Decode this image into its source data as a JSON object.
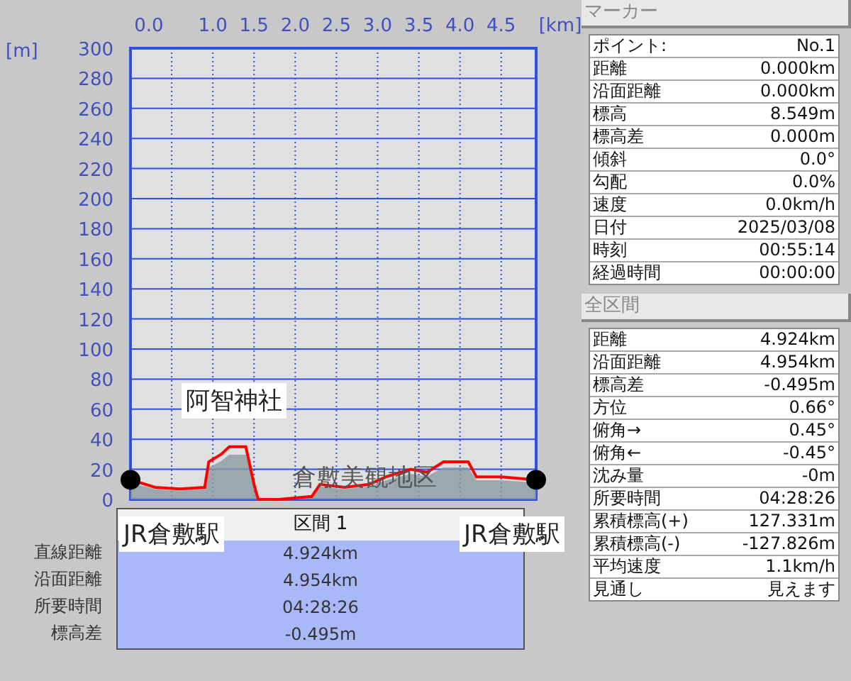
{
  "chart": {
    "chart_data": {
      "type": "line",
      "xlabel": "[km]",
      "ylabel": "[m]",
      "x": [
        0,
        0.3,
        0.6,
        0.9,
        0.95,
        1.1,
        1.2,
        1.4,
        1.5,
        1.55,
        1.8,
        2.2,
        2.3,
        2.6,
        2.9,
        3.1,
        3.4,
        3.6,
        3.8,
        4.1,
        4.2,
        4.5,
        4.924
      ],
      "grid": true,
      "series": [
        {
          "color": "#ff0000",
          "values": [
            13,
            8,
            7,
            8,
            25,
            30,
            35,
            35,
            10,
            0,
            0,
            2,
            10,
            8,
            10,
            15,
            20,
            18,
            25,
            25,
            15,
            15,
            13
          ]
        }
      ],
      "xlim": [
        0,
        4.924
      ],
      "ylim": [
        0,
        300
      ],
      "xticks": [
        {
          "value": 0,
          "label": "0.0"
        },
        {
          "value": 1,
          "label": "1.0"
        },
        {
          "value": 1.5,
          "label": "1.5"
        },
        {
          "value": 2,
          "label": "2.0"
        },
        {
          "value": 2.5,
          "label": "2.5"
        },
        {
          "value": 3,
          "label": "3.0"
        },
        {
          "value": 3.5,
          "label": "3.5"
        },
        {
          "value": 4,
          "label": "4.0"
        },
        {
          "value": 4.5,
          "label": "4.5"
        }
      ],
      "yticks": [
        0,
        20,
        40,
        60,
        80,
        100,
        120,
        140,
        160,
        180,
        200,
        220,
        240,
        260,
        280,
        300
      ]
    }
  },
  "place_labels": [
    {
      "text": "阿智神社",
      "kind": "boxed"
    },
    {
      "text": "倉敷美観地区",
      "kind": "plain"
    },
    {
      "text": "JR倉敷駅",
      "kind": "boxed"
    },
    {
      "text": "JR倉敷駅",
      "kind": "boxed"
    }
  ],
  "section": {
    "title": "区間 1",
    "rows": [
      {
        "label": "直線距離",
        "value": "4.924km"
      },
      {
        "label": "沿面距離",
        "value": "4.954km"
      },
      {
        "label": "所要時間",
        "value": "04:28:26"
      },
      {
        "label": "標高差",
        "value": "-0.495m"
      }
    ]
  },
  "marker_panel": {
    "title": "マーカー",
    "rows": [
      {
        "label": "ポイント:",
        "value": "No.1"
      },
      {
        "label": "距離",
        "value": "0.000km"
      },
      {
        "label": "沿面距離",
        "value": "0.000km"
      },
      {
        "label": "標高",
        "value": "8.549m"
      },
      {
        "label": "標高差",
        "value": "0.000m"
      },
      {
        "label": "傾斜",
        "value": "0.0°"
      },
      {
        "label": "勾配",
        "value": "0.0%"
      },
      {
        "label": "速度",
        "value": "0.0km/h"
      },
      {
        "label": "日付",
        "value": "2025/03/08"
      },
      {
        "label": "時刻",
        "value": "00:55:14"
      },
      {
        "label": "経過時間",
        "value": "00:00:00"
      }
    ]
  },
  "total_panel": {
    "title": "全区間",
    "rows": [
      {
        "label": "距離",
        "value": "4.924km"
      },
      {
        "label": "沿面距離",
        "value": "4.954km"
      },
      {
        "label": "標高差",
        "value": "-0.495m"
      },
      {
        "label": "方位",
        "value": "0.66°"
      },
      {
        "label": "俯角→",
        "value": "0.45°"
      },
      {
        "label": "俯角←",
        "value": "-0.45°"
      },
      {
        "label": "沈み量",
        "value": "-0m"
      },
      {
        "label": "所要時間",
        "value": "04:28:26"
      },
      {
        "label": "累積標高(+)",
        "value": "127.331m"
      },
      {
        "label": "累積標高(-)",
        "value": "-127.826m"
      },
      {
        "label": "平均速度",
        "value": "1.1km/h"
      },
      {
        "label": "見通し",
        "value": "見えます"
      }
    ]
  }
}
